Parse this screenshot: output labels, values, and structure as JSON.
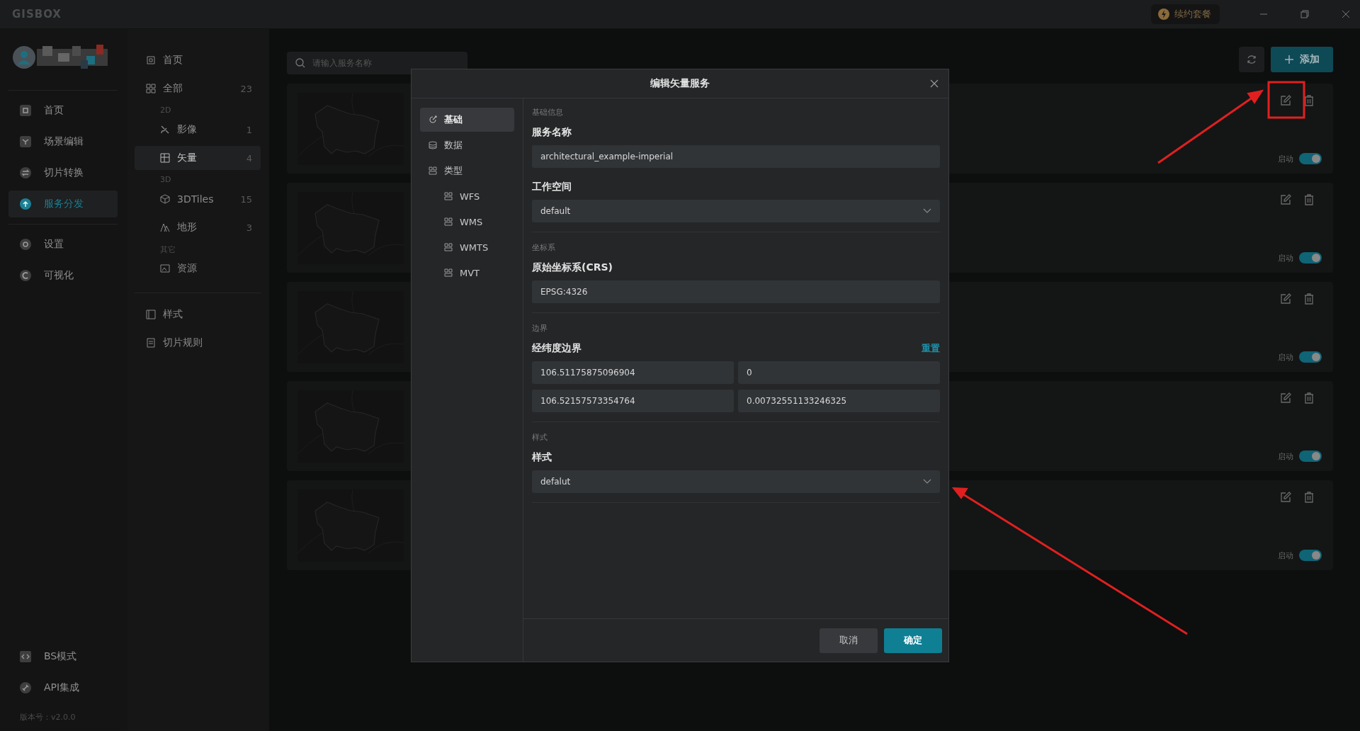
{
  "app": {
    "logo": "GISBOX",
    "renew_button": "续约套餐"
  },
  "nav": {
    "items": [
      {
        "label": "首页",
        "selected": false
      },
      {
        "label": "场景编辑",
        "selected": false
      },
      {
        "label": "切片转换",
        "selected": false
      },
      {
        "label": "服务分发",
        "selected": true
      },
      {
        "label": "设置",
        "selected": false
      },
      {
        "label": "可视化",
        "selected": false
      }
    ],
    "bottom_items": [
      {
        "label": "BS模式"
      },
      {
        "label": "API集成"
      }
    ],
    "version": "版本号：v2.0.0"
  },
  "library": {
    "items": [
      {
        "kind": "top",
        "label": "首页",
        "selected": false
      },
      {
        "kind": "top",
        "label": "全部",
        "count": "23",
        "selected": false
      },
      {
        "kind": "heading",
        "label": "2D"
      },
      {
        "kind": "child",
        "label": "影像",
        "count": "1",
        "selected": false
      },
      {
        "kind": "child",
        "label": "矢量",
        "count": "4",
        "selected": true
      },
      {
        "kind": "heading",
        "label": "3D"
      },
      {
        "kind": "child",
        "label": "3DTiles",
        "count": "15",
        "selected": false
      },
      {
        "kind": "child",
        "label": "地形",
        "count": "3",
        "selected": false
      },
      {
        "kind": "heading",
        "label": "其它"
      },
      {
        "kind": "child",
        "label": "资源",
        "selected": false
      }
    ],
    "extra_items": [
      {
        "label": "样式"
      },
      {
        "label": "切片规则"
      }
    ]
  },
  "search": {
    "placeholder": "请输入服务名称"
  },
  "add_button": "添加",
  "cards": [
    {
      "toggle_label": "启动",
      "on": true
    },
    {
      "toggle_label": "启动",
      "on": true
    },
    {
      "toggle_label": "启动",
      "on": true
    },
    {
      "toggle_label": "启动",
      "on": true
    },
    {
      "toggle_label": "启动",
      "on": true
    }
  ],
  "dialog": {
    "title": "编辑矢量服务",
    "menu": [
      {
        "label": "基础",
        "selected": true
      },
      {
        "label": "数据",
        "selected": false
      },
      {
        "label": "类型",
        "selected": false,
        "children": [
          {
            "label": "WFS",
            "selected": false
          },
          {
            "label": "WMS",
            "selected": false
          },
          {
            "label": "WMTS",
            "selected": false
          },
          {
            "label": "MVT",
            "selected": false
          }
        ]
      }
    ],
    "sections": [
      {
        "heading": "基础信息",
        "fields": [
          {
            "kind": "input",
            "label": "服务名称",
            "value": "architectural_example-imperial"
          },
          {
            "kind": "select",
            "label": "工作空间",
            "value": "default"
          }
        ]
      },
      {
        "heading": "坐标系",
        "fields": [
          {
            "kind": "input",
            "label": "原始坐标系(CRS)",
            "value": "EPSG:4326"
          }
        ]
      },
      {
        "heading": "边界",
        "fields": [
          {
            "kind": "grid",
            "label": "经纬度边界",
            "action": "重置",
            "values": [
              "106.51175875096904",
              "0",
              "106.52157573354764",
              "0.00732551133246325"
            ]
          }
        ]
      },
      {
        "heading": "样式",
        "fields": [
          {
            "kind": "select",
            "label": "样式",
            "value": "defalut"
          }
        ]
      }
    ],
    "cancel_button": "取消",
    "confirm_button": "确定"
  }
}
